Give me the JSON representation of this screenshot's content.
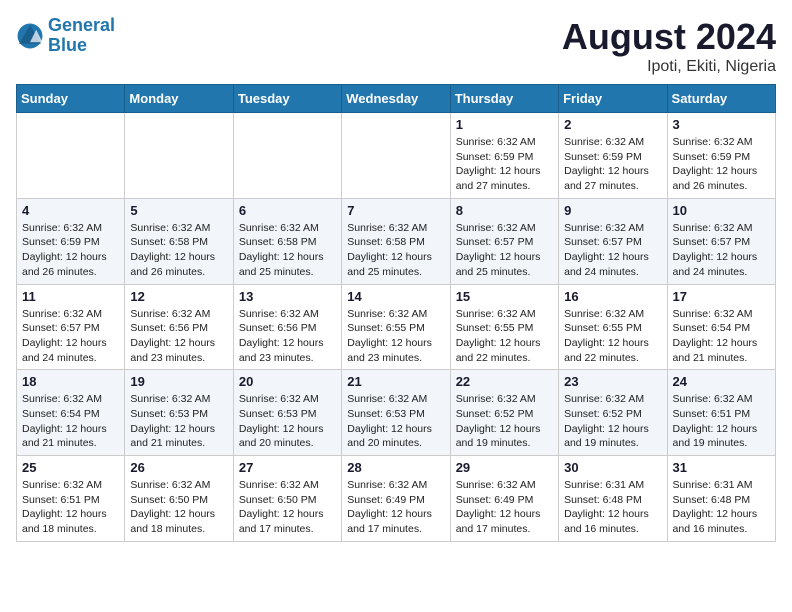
{
  "logo": {
    "text_general": "General",
    "text_blue": "Blue"
  },
  "title": "August 2024",
  "location": "Ipoti, Ekiti, Nigeria",
  "header_days": [
    "Sunday",
    "Monday",
    "Tuesday",
    "Wednesday",
    "Thursday",
    "Friday",
    "Saturday"
  ],
  "weeks": [
    [
      {
        "day": "",
        "info": ""
      },
      {
        "day": "",
        "info": ""
      },
      {
        "day": "",
        "info": ""
      },
      {
        "day": "",
        "info": ""
      },
      {
        "day": "1",
        "info": "Sunrise: 6:32 AM\nSunset: 6:59 PM\nDaylight: 12 hours\nand 27 minutes."
      },
      {
        "day": "2",
        "info": "Sunrise: 6:32 AM\nSunset: 6:59 PM\nDaylight: 12 hours\nand 27 minutes."
      },
      {
        "day": "3",
        "info": "Sunrise: 6:32 AM\nSunset: 6:59 PM\nDaylight: 12 hours\nand 26 minutes."
      }
    ],
    [
      {
        "day": "4",
        "info": "Sunrise: 6:32 AM\nSunset: 6:59 PM\nDaylight: 12 hours\nand 26 minutes."
      },
      {
        "day": "5",
        "info": "Sunrise: 6:32 AM\nSunset: 6:58 PM\nDaylight: 12 hours\nand 26 minutes."
      },
      {
        "day": "6",
        "info": "Sunrise: 6:32 AM\nSunset: 6:58 PM\nDaylight: 12 hours\nand 25 minutes."
      },
      {
        "day": "7",
        "info": "Sunrise: 6:32 AM\nSunset: 6:58 PM\nDaylight: 12 hours\nand 25 minutes."
      },
      {
        "day": "8",
        "info": "Sunrise: 6:32 AM\nSunset: 6:57 PM\nDaylight: 12 hours\nand 25 minutes."
      },
      {
        "day": "9",
        "info": "Sunrise: 6:32 AM\nSunset: 6:57 PM\nDaylight: 12 hours\nand 24 minutes."
      },
      {
        "day": "10",
        "info": "Sunrise: 6:32 AM\nSunset: 6:57 PM\nDaylight: 12 hours\nand 24 minutes."
      }
    ],
    [
      {
        "day": "11",
        "info": "Sunrise: 6:32 AM\nSunset: 6:57 PM\nDaylight: 12 hours\nand 24 minutes."
      },
      {
        "day": "12",
        "info": "Sunrise: 6:32 AM\nSunset: 6:56 PM\nDaylight: 12 hours\nand 23 minutes."
      },
      {
        "day": "13",
        "info": "Sunrise: 6:32 AM\nSunset: 6:56 PM\nDaylight: 12 hours\nand 23 minutes."
      },
      {
        "day": "14",
        "info": "Sunrise: 6:32 AM\nSunset: 6:55 PM\nDaylight: 12 hours\nand 23 minutes."
      },
      {
        "day": "15",
        "info": "Sunrise: 6:32 AM\nSunset: 6:55 PM\nDaylight: 12 hours\nand 22 minutes."
      },
      {
        "day": "16",
        "info": "Sunrise: 6:32 AM\nSunset: 6:55 PM\nDaylight: 12 hours\nand 22 minutes."
      },
      {
        "day": "17",
        "info": "Sunrise: 6:32 AM\nSunset: 6:54 PM\nDaylight: 12 hours\nand 21 minutes."
      }
    ],
    [
      {
        "day": "18",
        "info": "Sunrise: 6:32 AM\nSunset: 6:54 PM\nDaylight: 12 hours\nand 21 minutes."
      },
      {
        "day": "19",
        "info": "Sunrise: 6:32 AM\nSunset: 6:53 PM\nDaylight: 12 hours\nand 21 minutes."
      },
      {
        "day": "20",
        "info": "Sunrise: 6:32 AM\nSunset: 6:53 PM\nDaylight: 12 hours\nand 20 minutes."
      },
      {
        "day": "21",
        "info": "Sunrise: 6:32 AM\nSunset: 6:53 PM\nDaylight: 12 hours\nand 20 minutes."
      },
      {
        "day": "22",
        "info": "Sunrise: 6:32 AM\nSunset: 6:52 PM\nDaylight: 12 hours\nand 19 minutes."
      },
      {
        "day": "23",
        "info": "Sunrise: 6:32 AM\nSunset: 6:52 PM\nDaylight: 12 hours\nand 19 minutes."
      },
      {
        "day": "24",
        "info": "Sunrise: 6:32 AM\nSunset: 6:51 PM\nDaylight: 12 hours\nand 19 minutes."
      }
    ],
    [
      {
        "day": "25",
        "info": "Sunrise: 6:32 AM\nSunset: 6:51 PM\nDaylight: 12 hours\nand 18 minutes."
      },
      {
        "day": "26",
        "info": "Sunrise: 6:32 AM\nSunset: 6:50 PM\nDaylight: 12 hours\nand 18 minutes."
      },
      {
        "day": "27",
        "info": "Sunrise: 6:32 AM\nSunset: 6:50 PM\nDaylight: 12 hours\nand 17 minutes."
      },
      {
        "day": "28",
        "info": "Sunrise: 6:32 AM\nSunset: 6:49 PM\nDaylight: 12 hours\nand 17 minutes."
      },
      {
        "day": "29",
        "info": "Sunrise: 6:32 AM\nSunset: 6:49 PM\nDaylight: 12 hours\nand 17 minutes."
      },
      {
        "day": "30",
        "info": "Sunrise: 6:31 AM\nSunset: 6:48 PM\nDaylight: 12 hours\nand 16 minutes."
      },
      {
        "day": "31",
        "info": "Sunrise: 6:31 AM\nSunset: 6:48 PM\nDaylight: 12 hours\nand 16 minutes."
      }
    ]
  ]
}
